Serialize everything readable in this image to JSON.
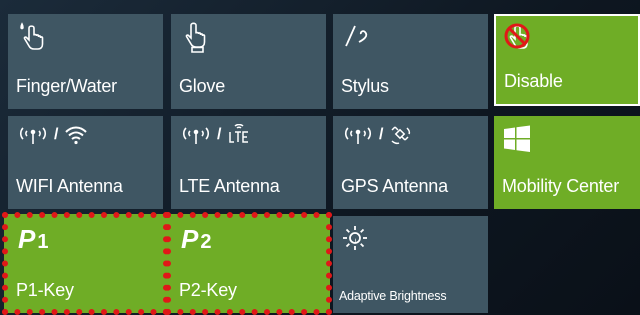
{
  "tiles": {
    "finger_water": {
      "label": "Finger/Water",
      "icon": "finger-water-icon"
    },
    "glove": {
      "label": "Glove",
      "icon": "glove-touch-icon"
    },
    "stylus": {
      "label": "Stylus",
      "icon": "stylus-icon"
    },
    "disable": {
      "label": "Disable",
      "icon": "touch-disabled-icon"
    },
    "wifi_antenna": {
      "label": "WIFI Antenna",
      "icon": "wifi-antenna-icon"
    },
    "lte_antenna": {
      "label": "LTE Antenna",
      "icon": "lte-antenna-icon"
    },
    "gps_antenna": {
      "label": "GPS Antenna",
      "icon": "gps-antenna-icon"
    },
    "mobility_center": {
      "label": "Mobility Center",
      "icon": "windows-icon"
    },
    "p1_key": {
      "label": "P1-Key",
      "glyph": "P",
      "num": "1"
    },
    "p2_key": {
      "label": "P2-Key",
      "glyph": "P",
      "num": "2"
    },
    "adaptive_brightness": {
      "label": "Adaptive Brightness",
      "icon": "brightness-icon"
    }
  },
  "separator": "/",
  "colors": {
    "tile_gray": "#3f5663",
    "tile_green": "#6fad26",
    "highlight_dotted": "#e01818",
    "disabled_symbol": "#e01818"
  }
}
